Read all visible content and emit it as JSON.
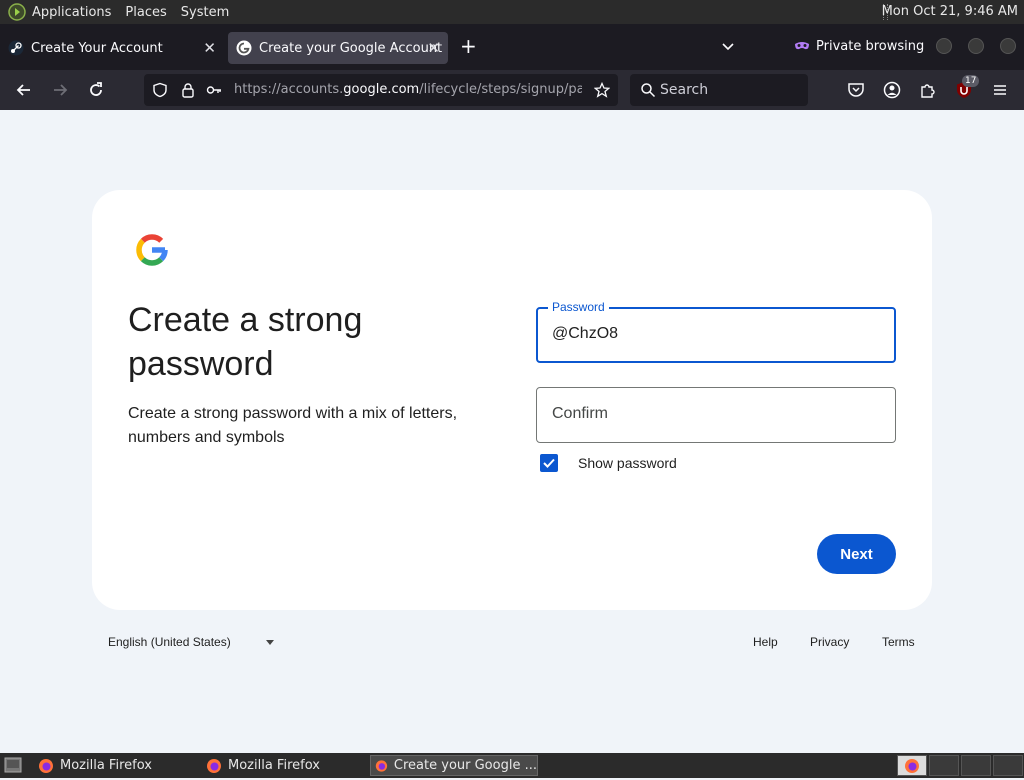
{
  "panel": {
    "menus": [
      "Applications",
      "Places",
      "System"
    ],
    "clock": "Mon Oct 21,  9:46 AM"
  },
  "tabs": [
    {
      "title": "Create Your Account"
    },
    {
      "title": "Create your Google Account"
    }
  ],
  "private_browsing": "Private browsing",
  "url": {
    "prefix": "https://accounts.",
    "host": "google.com",
    "path": "/lifecycle/steps/signup/password"
  },
  "search": {
    "placeholder": "Search"
  },
  "ublock_count": "17",
  "page": {
    "heading": "Create a strong password",
    "subtext": "Create a strong password with a mix of letters, numbers and symbols",
    "password_label": "Password",
    "password_value": "@ChzO8",
    "confirm_placeholder": "Confirm",
    "show_password_label": "Show password",
    "show_password_checked": true,
    "next_label": "Next"
  },
  "footer": {
    "language": "English (United States)",
    "links": [
      "Help",
      "Privacy",
      "Terms"
    ]
  },
  "taskbar": {
    "tasks": [
      "Mozilla Firefox",
      "Mozilla Firefox",
      "Create your Google ..."
    ]
  },
  "colors": {
    "accent": "#0b57d0",
    "page_bg": "#f0f4f9"
  }
}
